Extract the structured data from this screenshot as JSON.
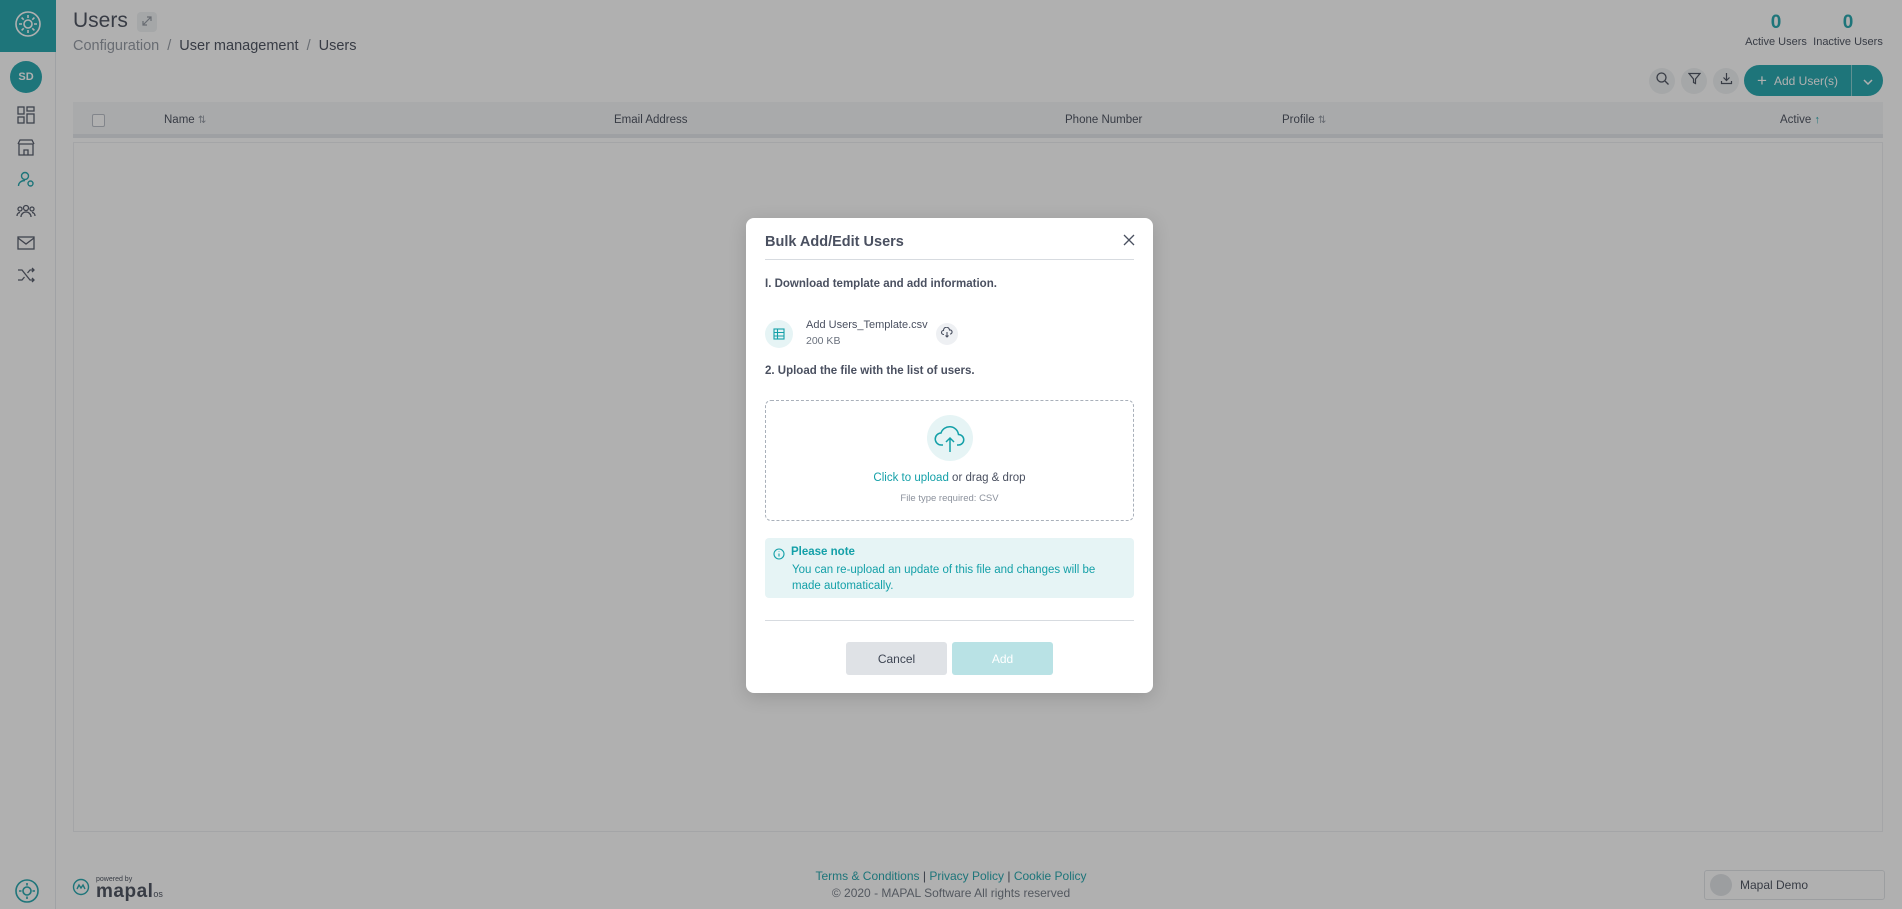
{
  "sidebar": {
    "avatar_initials": "SD",
    "icons": [
      "dashboard-icon",
      "store-icon",
      "user-settings-icon",
      "team-icon",
      "mail-icon",
      "shuffle-icon"
    ],
    "brand_color": "#14a0a8"
  },
  "header": {
    "title": "Users",
    "breadcrumb": [
      "Configuration",
      "User management",
      "Users"
    ]
  },
  "stats": {
    "active_count": "0",
    "active_label": "Active Users",
    "inactive_count": "0",
    "inactive_label": "Inactive Users"
  },
  "toolbar": {
    "add_label": "Add User(s)"
  },
  "table": {
    "columns": [
      "Name",
      "Email Address",
      "Phone Number",
      "Profile",
      "Active"
    ],
    "rows": []
  },
  "footer": {
    "powered_by": "powered by",
    "brand": "mapal",
    "brand_suffix": "os",
    "links": [
      "Terms & Conditions",
      "Privacy Policy",
      "Cookie Policy"
    ],
    "copyright": "© 2020 - MAPAL Software All rights reserved",
    "user_name": "Mapal Demo"
  },
  "modal": {
    "title": "Bulk Add/Edit Users",
    "step1": "I. Download template and add information.",
    "file_name": "Add Users_Template.csv",
    "file_size": "200 KB",
    "step2": "2. Upload the file with the list of users.",
    "upload_link": "Click to upload",
    "upload_rest": " or drag & drop",
    "upload_hint": "File type required: CSV",
    "note_title": "Please note",
    "note_body": "You can re-upload an update of this file and changes will be made automatically.",
    "cancel_label": "Cancel",
    "add_label": "Add"
  }
}
